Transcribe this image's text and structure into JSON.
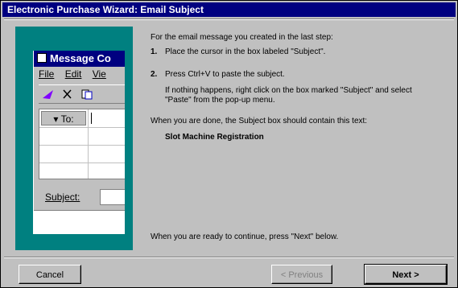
{
  "window": {
    "title": "Electronic Purchase Wizard: Email Subject"
  },
  "snapshot": {
    "title": "Message Co",
    "menu": [
      "File",
      "Edit",
      "Vie"
    ],
    "to_label": "To:",
    "subject_label": "Subject:"
  },
  "instructions": {
    "intro": "For the email message you created in the last step:",
    "step1_num": "1.",
    "step1_text": "Place the cursor in the box labeled \"Subject\".",
    "step2_num": "2.",
    "step2_text": "Press Ctrl+V to paste the subject.",
    "step2_note_1": "If nothing happens, right click on the box marked \"Subject\" and select",
    "step2_note_2": "\"Paste\" from the pop-up menu.",
    "when_done": "When you are done, the Subject box should contain this text:",
    "subject_text": "Slot Machine Registration",
    "continue": "When you are ready to continue, press \"Next\" below."
  },
  "buttons": {
    "cancel": "Cancel",
    "previous": "< Previous",
    "next": "Next >"
  },
  "colors": {
    "title_bar": "#000080",
    "panel_bg": "#008080",
    "dialog_bg": "#c0c0c0"
  }
}
